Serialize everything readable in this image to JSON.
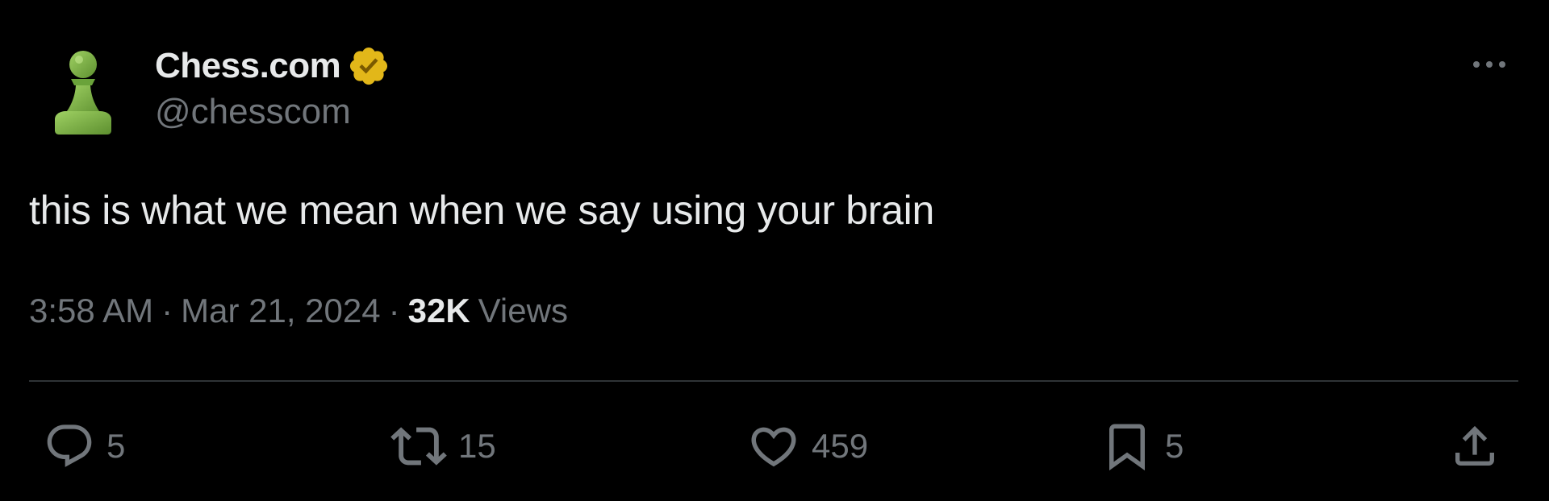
{
  "account": {
    "display_name": "Chess.com",
    "handle": "@chesscom",
    "avatar_icon": "pawn-icon",
    "verified_icon": "verified-badge-icon",
    "verified_color": "#e2b719"
  },
  "tweet": {
    "text": "this is what we mean when we say using your brain",
    "time": "3:58 AM",
    "date": "Mar 21, 2024",
    "views_count": "32K",
    "views_label": "Views",
    "separator": "·"
  },
  "actions": {
    "replies": {
      "icon": "reply-icon",
      "count": "5"
    },
    "reposts": {
      "icon": "repost-icon",
      "count": "15"
    },
    "likes": {
      "icon": "heart-icon",
      "count": "459"
    },
    "bookmarks": {
      "icon": "bookmark-icon",
      "count": "5"
    },
    "share": {
      "icon": "share-icon"
    }
  },
  "more_menu": {
    "icon": "more-dots-icon"
  },
  "colors": {
    "background": "#000000",
    "text_primary": "#e7e9ea",
    "text_secondary": "#71767b",
    "divider": "#2f3336",
    "pawn_green": "#81b64c"
  }
}
